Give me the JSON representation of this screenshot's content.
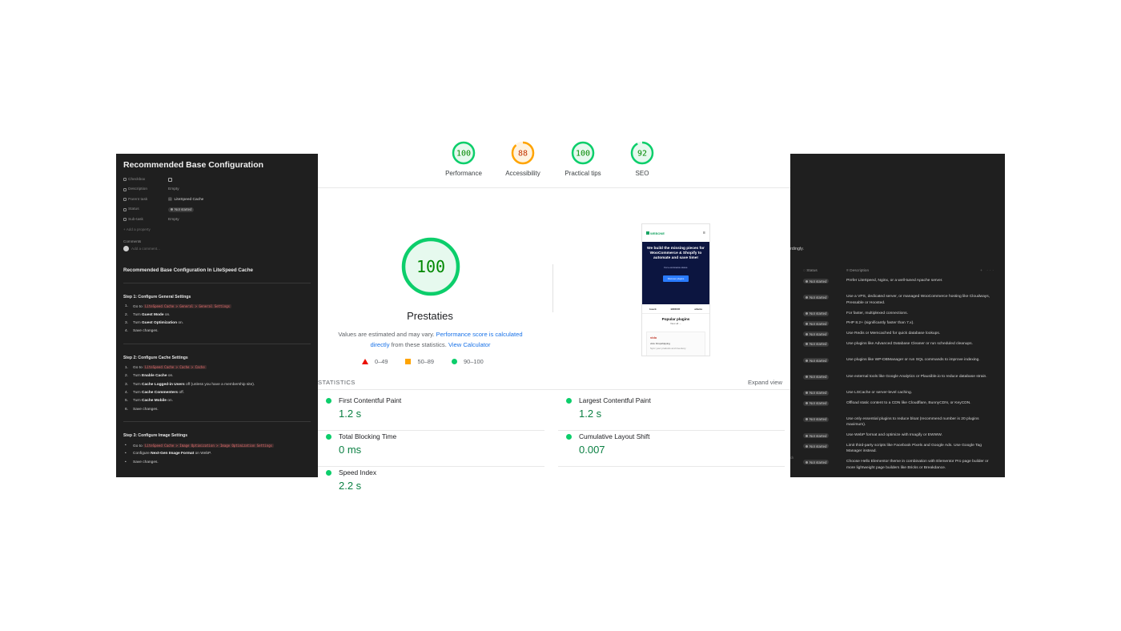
{
  "left_panel": {
    "title": "Recommended Base Configuration",
    "properties": [
      {
        "key": "Checkbox",
        "value": "",
        "type": "checkbox",
        "icon": "checkbox-icon"
      },
      {
        "key": "Description",
        "value": "Empty",
        "type": "text",
        "icon": "text-icon"
      },
      {
        "key": "Parent task",
        "value": "LiteSpeed Cache",
        "type": "relation",
        "icon": "arrow-icon"
      },
      {
        "key": "Status",
        "value": "Not started",
        "type": "status",
        "icon": "status-icon"
      },
      {
        "key": "Sub-task",
        "value": "Empty",
        "type": "text",
        "icon": "arrow-icon"
      }
    ],
    "add_property": "+ Add a property",
    "comments_label": "Comments",
    "comment_placeholder": "Add a comment...",
    "heading": "Recommended Base Configuration In LiteSpeed Cache",
    "steps": [
      {
        "title": "Step 1: Configure General Settings",
        "items": [
          {
            "num": "1.",
            "pre": "Go to ",
            "code": "LiteSpeed Cache > General > General Settings",
            "bold": "",
            "post": ""
          },
          {
            "num": "2.",
            "pre": "Turn ",
            "code": "",
            "bold": "Guest Mode",
            "post": " on."
          },
          {
            "num": "3.",
            "pre": "Turn ",
            "code": "",
            "bold": "Guest Optimization",
            "post": " on."
          },
          {
            "num": "4.",
            "pre": "Save changes.",
            "code": "",
            "bold": "",
            "post": ""
          }
        ]
      },
      {
        "title": "Step 2: Configure Cache Settings",
        "items": [
          {
            "num": "1.",
            "pre": "Go to ",
            "code": "LiteSpeed Cache > Cache > Cache",
            "bold": "",
            "post": ""
          },
          {
            "num": "2.",
            "pre": "Turn ",
            "code": "",
            "bold": "Enable Cache",
            "post": " on."
          },
          {
            "num": "3.",
            "pre": "Turn ",
            "code": "",
            "bold": "Cache Logged-in Users",
            "post": " off (unless you have a membership site)."
          },
          {
            "num": "4.",
            "pre": "Turn ",
            "code": "",
            "bold": "Cache Commenters",
            "post": " off."
          },
          {
            "num": "5.",
            "pre": "Turn ",
            "code": "",
            "bold": "Cache Mobile",
            "post": " on."
          },
          {
            "num": "6.",
            "pre": "Save changes.",
            "code": "",
            "bold": "",
            "post": ""
          }
        ]
      },
      {
        "title": "Step 3: Configure Image Settings",
        "items": [
          {
            "num": "•",
            "pre": "Go to ",
            "code": "LiteSpeed Cache > Image Optimization > Image Optimization Settings",
            "bold": "",
            "post": ""
          },
          {
            "num": "•",
            "pre": "Configure ",
            "code": "",
            "bold": "Next-Gen Image Format",
            "post": " on WebP."
          },
          {
            "num": "•",
            "pre": "Save changes.",
            "code": "",
            "bold": "",
            "post": ""
          }
        ]
      }
    ]
  },
  "center": {
    "gauges": [
      {
        "score": 100,
        "label": "Performance",
        "color": "#0cce6b",
        "text_color": "#008800"
      },
      {
        "score": 88,
        "label": "Accessibility",
        "color": "#ffa400",
        "text_color": "#c33300"
      },
      {
        "score": 100,
        "label": "Practical tips",
        "color": "#0cce6b",
        "text_color": "#008800"
      },
      {
        "score": 92,
        "label": "SEO",
        "color": "#0cce6b",
        "text_color": "#008800"
      }
    ],
    "main_score": 100,
    "main_title": "Prestaties",
    "desc_pre": "Values are estimated and may vary. ",
    "desc_link": "Performance score is calculated directly",
    "desc_mid": " from these statistics. ",
    "desc_link2": "View Calculator",
    "legend": [
      {
        "range": "0–49",
        "shape": "triangle",
        "color": "#eb0f00"
      },
      {
        "range": "50–89",
        "shape": "square",
        "color": "#ffa400"
      },
      {
        "range": "90–100",
        "shape": "circle",
        "color": "#0cce6b"
      }
    ],
    "preview": {
      "logo": "WEBONE",
      "hero_title": "We build the missing pieces for WooCommerce & Shopify to automate and save time!",
      "hero_sub": "For e-commerce stores",
      "hero_button": "Discover plugins",
      "brands": [
        "boeck",
        "BIDDUR",
        "atlanta"
      ],
      "popular_title": "Popular plugins",
      "popular_sub": "View all →",
      "card_logo": "vido",
      "card_title": "vido: Dropshipping",
      "card_sub": "Sync your products and inventory"
    },
    "stats_label": "STATISTICS",
    "expand_label": "Expand view",
    "metrics": [
      {
        "name": "First Contentful Paint",
        "value": "1.2 s"
      },
      {
        "name": "Largest Contentful Paint",
        "value": "1.2 s"
      },
      {
        "name": "Total Blocking Time",
        "value": "0 ms"
      },
      {
        "name": "Cumulative Layout Shift",
        "value": "0.007"
      },
      {
        "name": "Speed Index",
        "value": "2.2 s"
      }
    ]
  },
  "right_panel": {
    "top_text": "rdingly.",
    "header_status": "Status",
    "header_desc": "Description",
    "header_more": "+ ···",
    "side_text": "ck",
    "rows": [
      {
        "status": "Not started",
        "desc": "Prefer LiteSpeed, Nginx, or a well-tuned Apache server."
      },
      {
        "status": "Not started",
        "desc": "Use a VPS, dedicated server, or managed WooCommerce hosting like Cloudways, Pressable or Hoosted."
      },
      {
        "status": "Not started",
        "desc": "For faster, multiplexed connections."
      },
      {
        "status": "Not started",
        "desc": "PHP 8.2+ (significantly faster than 7.x)."
      },
      {
        "status": "Not started",
        "desc": "Use Redis or Memcached for quick database lookups."
      },
      {
        "status": "Not started",
        "desc": "Use plugins like Advanced Database Cleaner or run scheduled cleanups."
      },
      {
        "status": "Not started",
        "desc": "Use plugins like WP-DBManager or run SQL commands to improve indexing."
      },
      {
        "status": "Not started",
        "desc": "Use external tools like Google Analytics or Plausible.io to reduce database strain."
      },
      {
        "status": "Not started",
        "desc": "Use LSCache or server-level caching."
      },
      {
        "status": "Not started",
        "desc": "Offload static content to a CDN like Cloudflare, BunnyCDN, or KeyCDN."
      },
      {
        "status": "Not started",
        "desc": "Use only essential plugins to reduce bloat (recommend number is 20 plugins maximum)."
      },
      {
        "status": "Not started",
        "desc": "Use WebP format and optimize with Imagify or EWWW."
      },
      {
        "status": "Not started",
        "desc": "Limit third-party scripts like Facebook Pixels and Google Ads. Use Google Tag Manager instead."
      },
      {
        "status": "Not started",
        "desc": "Choose Hello Elementor theme in combination with Elementor Pro page builder or more lightweight page builders like Bricks or Breakdance."
      }
    ]
  }
}
